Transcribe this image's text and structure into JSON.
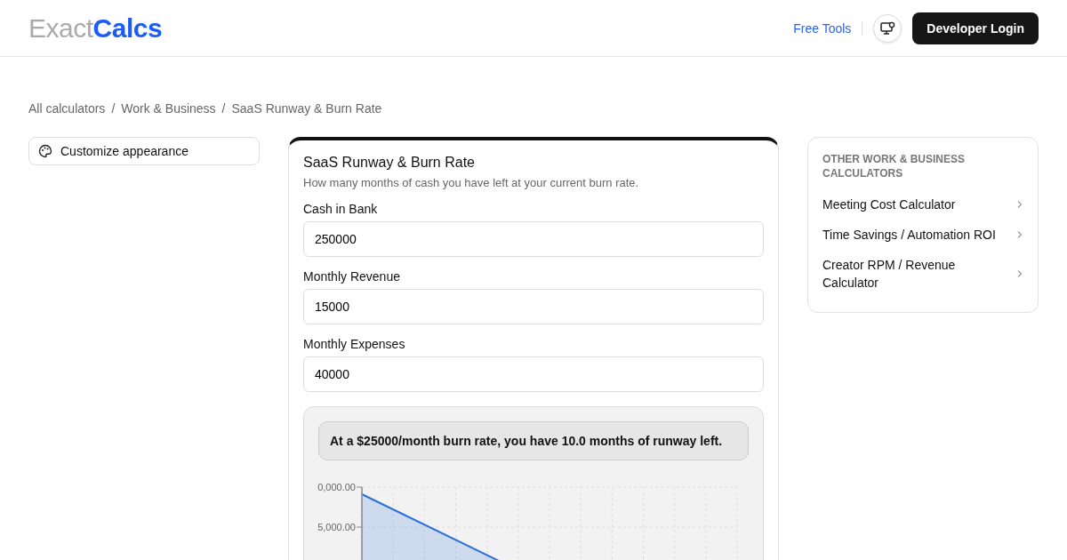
{
  "header": {
    "logo": {
      "light": "Exact",
      "bold": "Calcs"
    },
    "nav_link": "Free Tools",
    "login_button": "Developer Login"
  },
  "breadcrumb": {
    "separator": "/",
    "items": [
      "All calculators",
      "Work & Business",
      "SaaS Runway & Burn Rate"
    ]
  },
  "customize_button": "Customize appearance",
  "calculator": {
    "title": "SaaS Runway & Burn Rate",
    "subtitle": "How many months of cash you have left at your current burn rate.",
    "fields": [
      {
        "label": "Cash in Bank",
        "value": "250000"
      },
      {
        "label": "Monthly Revenue",
        "value": "15000"
      },
      {
        "label": "Monthly Expenses",
        "value": "40000"
      }
    ],
    "result": "At a $25000/month burn rate, you have 10.0 months of runway left.",
    "chart": {
      "y_labels": [
        "0,000.00",
        "5,000.00"
      ]
    }
  },
  "sidebar": {
    "title": "OTHER WORK & BUSINESS CALCULATORS",
    "items": [
      "Meeting Cost Calculator",
      "Time Savings / Automation ROI",
      "Creator RPM / Revenue Calculator"
    ]
  }
}
